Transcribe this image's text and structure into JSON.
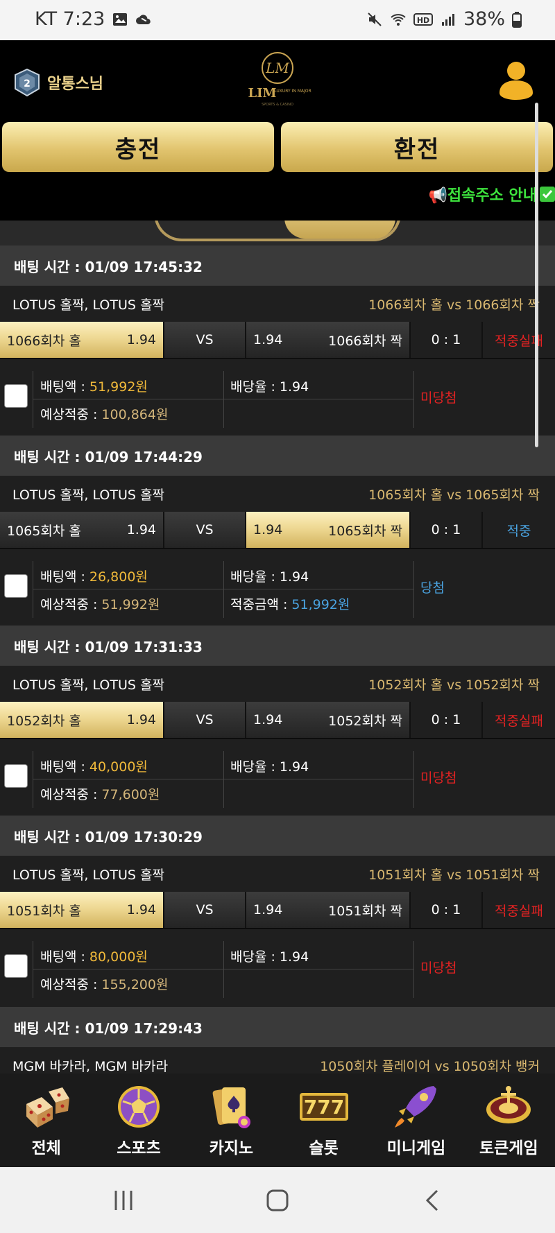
{
  "status_bar": {
    "carrier_time": "KT 7:23",
    "battery": "38%",
    "icons": [
      "image-icon",
      "cloud-icon",
      "mute-icon",
      "wifi-icon",
      "hd-icon",
      "signal-icon",
      "battery-icon"
    ]
  },
  "header": {
    "user_name": "알통스님",
    "logo_text": "LIM",
    "logo_sub": "LUXURY IN MAJOR",
    "logo_sub2": "SPORTS & CASINO",
    "charge_label": "충전",
    "exchange_label": "환전",
    "notice": "📢접속주소 안내"
  },
  "bets": [
    {
      "time": "배팅 시간 : 01/09 17:45:32",
      "game": "LOTUS 홀짝, LOTUS 홀짝",
      "match": "1066회차 홀  vs  1066회차 짝",
      "home": "1066회차 홀",
      "home_odds": "1.94",
      "vs": "VS",
      "away_odds": "1.94",
      "away": "1066회차 짝",
      "selected": "home",
      "score": "0 : 1",
      "result": "적중실패",
      "result_type": "fail",
      "bet_label": "배팅액 : ",
      "bet_amount": "51,992원",
      "rate_label": "배당율 : ",
      "rate": "1.94",
      "expected_label": "예상적중 : ",
      "expected": "100,864원",
      "win_label": "",
      "win_amount": "",
      "status": "미당첨",
      "status_type": "lose"
    },
    {
      "time": "배팅 시간 : 01/09 17:44:29",
      "game": "LOTUS 홀짝, LOTUS 홀짝",
      "match": "1065회차 홀  vs  1065회차 짝",
      "home": "1065회차 홀",
      "home_odds": "1.94",
      "vs": "VS",
      "away_odds": "1.94",
      "away": "1065회차 짝",
      "selected": "away",
      "score": "0 : 1",
      "result": "적중",
      "result_type": "hit",
      "bet_label": "배팅액 : ",
      "bet_amount": "26,800원",
      "rate_label": "배당율 : ",
      "rate": "1.94",
      "expected_label": "예상적중 : ",
      "expected": "51,992원",
      "win_label": "적중금액 : ",
      "win_amount": "51,992원",
      "status": "당첨",
      "status_type": "win"
    },
    {
      "time": "배팅 시간 : 01/09 17:31:33",
      "game": "LOTUS 홀짝, LOTUS 홀짝",
      "match": "1052회차 홀  vs  1052회차 짝",
      "home": "1052회차 홀",
      "home_odds": "1.94",
      "vs": "VS",
      "away_odds": "1.94",
      "away": "1052회차 짝",
      "selected": "home",
      "score": "0 : 1",
      "result": "적중실패",
      "result_type": "fail",
      "bet_label": "배팅액 : ",
      "bet_amount": "40,000원",
      "rate_label": "배당율 : ",
      "rate": "1.94",
      "expected_label": "예상적중 : ",
      "expected": "77,600원",
      "win_label": "",
      "win_amount": "",
      "status": "미당첨",
      "status_type": "lose"
    },
    {
      "time": "배팅 시간 : 01/09 17:30:29",
      "game": "LOTUS 홀짝, LOTUS 홀짝",
      "match": "1051회차 홀  vs  1051회차 짝",
      "home": "1051회차 홀",
      "home_odds": "1.94",
      "vs": "VS",
      "away_odds": "1.94",
      "away": "1051회차 짝",
      "selected": "home",
      "score": "0 : 1",
      "result": "적중실패",
      "result_type": "fail",
      "bet_label": "배팅액 : ",
      "bet_amount": "80,000원",
      "rate_label": "배당율 : ",
      "rate": "1.94",
      "expected_label": "예상적중 : ",
      "expected": "155,200원",
      "win_label": "",
      "win_amount": "",
      "status": "미당첨",
      "status_type": "lose"
    }
  ],
  "partial_bet": {
    "time": "배팅 시간 : 01/09 17:29:43",
    "game": "MGM 바카라, MGM 바카라",
    "match": "1050회차 플레이어  vs  1050회차 뱅커"
  },
  "bottom_nav": [
    {
      "label": "전체",
      "icon": "dice-icon"
    },
    {
      "label": "스포츠",
      "icon": "soccer-ball-icon"
    },
    {
      "label": "카지노",
      "icon": "cards-icon"
    },
    {
      "label": "슬롯",
      "icon": "slot-777-icon"
    },
    {
      "label": "미니게임",
      "icon": "rocket-icon"
    },
    {
      "label": "토큰게임",
      "icon": "roulette-icon"
    }
  ],
  "colors": {
    "gold": "#e1c46e",
    "fail_red": "#e62222",
    "hit_blue": "#4aa3e0",
    "notice_green": "#3de23d",
    "amount_gold": "#f0b93a"
  }
}
